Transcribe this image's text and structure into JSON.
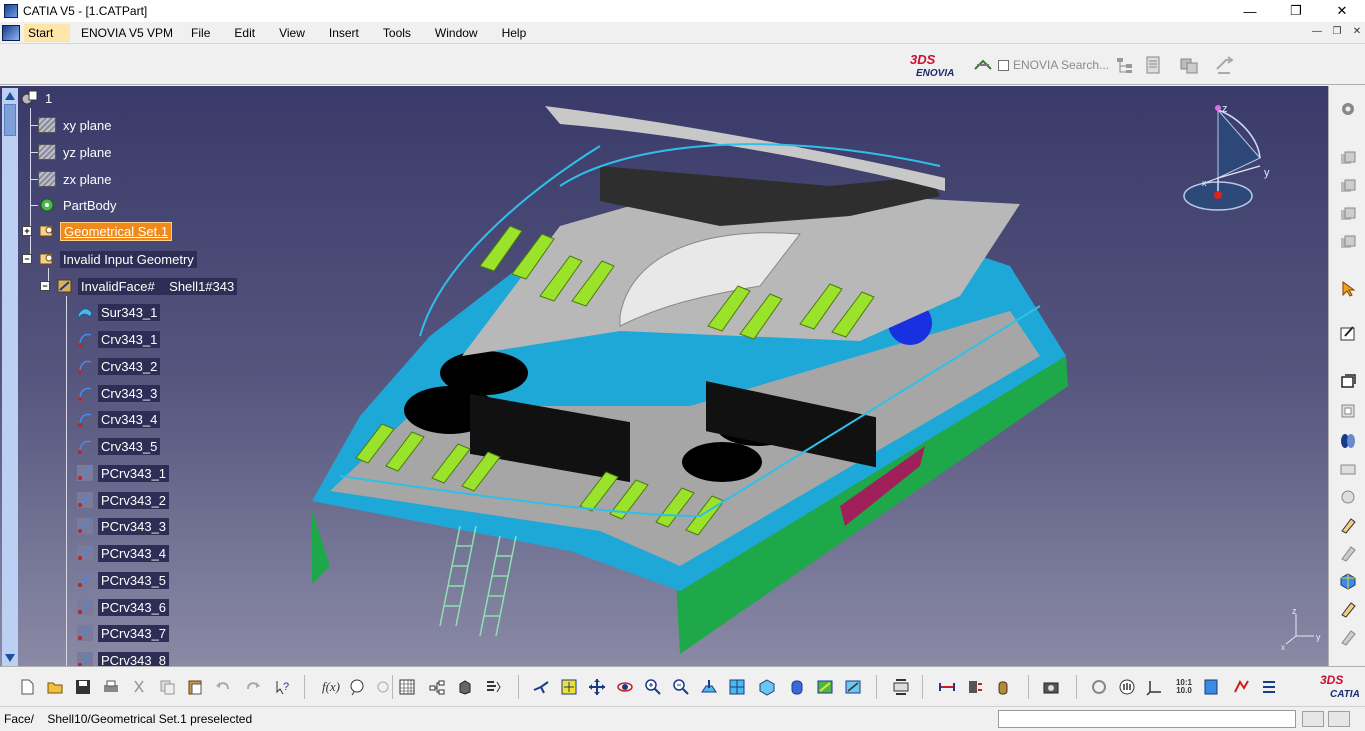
{
  "window": {
    "title": "CATIA V5 - [1.CATPart]",
    "controls": {
      "minimize": "—",
      "maximize": "❐",
      "close": "✕"
    }
  },
  "menu": {
    "items": [
      "Start",
      "ENOVIA V5 VPM",
      "File",
      "Edit",
      "View",
      "Insert",
      "Tools",
      "Window",
      "Help"
    ]
  },
  "toolbar_top": {
    "enovia_logo_top": "3DS",
    "enovia_logo_bottom": "ENOVIA",
    "enovia_search": "ENOVIA Search..."
  },
  "tree": {
    "root": "1",
    "items": [
      "xy plane",
      "yz plane",
      "zx plane",
      "PartBody",
      "Geometrical Set.1",
      "Invalid Input Geometry",
      "InvalidFace#    Shell1#343",
      "Sur343_1",
      "Crv343_1",
      "Crv343_2",
      "Crv343_3",
      "Crv343_4",
      "Crv343_5",
      "PCrv343_1",
      "PCrv343_2",
      "PCrv343_3",
      "PCrv343_4",
      "PCrv343_5",
      "PCrv343_6",
      "PCrv343_7",
      "PCrv343_8"
    ]
  },
  "compass": {
    "z": "z",
    "y": "y",
    "x": "x"
  },
  "mini_axes": {
    "z": "z",
    "y": "y",
    "x": "x"
  },
  "bottom_toolbar": {
    "catia_logo_top": "3DS",
    "catia_logo_bottom": "CATIA",
    "fx_label": "f(x)",
    "scale_label": "10:1 10.0"
  },
  "status": {
    "text": "Face/    Shell10/Geometrical Set.1 preselected",
    "command_value": ""
  },
  "colors": {
    "viewport_top": "#3a3a6a",
    "viewport_bottom": "#8a8aa6",
    "hull_green": "#1fa84a",
    "deck_cyan": "#1ea8d8",
    "lounger": "#9be22a",
    "selection": "#f08a1a"
  }
}
